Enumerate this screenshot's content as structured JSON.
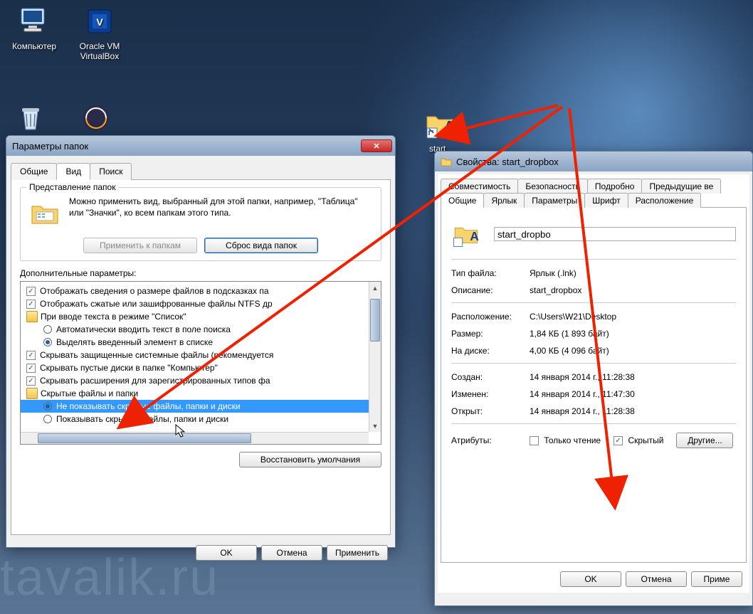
{
  "watermark": "tavalik.ru",
  "desktop": {
    "computer": "Компьютер",
    "virtualbox": "Oracle VM VirtualBox",
    "start_dropbox": "start_"
  },
  "folderOptions": {
    "title": "Параметры папок",
    "tabs": {
      "general": "Общие",
      "view": "Вид",
      "search": "Поиск"
    },
    "folderViews": {
      "legend": "Представление папок",
      "desc": "Можно применить вид, выбранный для этой папки, например, \"Таблица\" или \"Значки\", ко всем папкам этого типа.",
      "apply": "Применить к папкам",
      "reset": "Сброс вида папок"
    },
    "advLabel": "Дополнительные параметры:",
    "tree": [
      {
        "type": "chk",
        "checked": true,
        "indent": 0,
        "text": "Отображать сведения о размере файлов в подсказках па"
      },
      {
        "type": "chk",
        "checked": true,
        "indent": 0,
        "text": "Отображать сжатые или зашифрованные файлы NTFS др"
      },
      {
        "type": "folder",
        "indent": 0,
        "text": "При вводе текста в режиме \"Список\""
      },
      {
        "type": "radio",
        "sel": false,
        "indent": 1,
        "text": "Автоматически вводить текст в поле поиска"
      },
      {
        "type": "radio",
        "sel": true,
        "indent": 1,
        "text": "Выделять введенный элемент в списке"
      },
      {
        "type": "chk",
        "checked": true,
        "indent": 0,
        "text": "Скрывать защищенные системные файлы (рекомендуется"
      },
      {
        "type": "chk",
        "checked": true,
        "indent": 0,
        "text": "Скрывать пустые диски в папке \"Компьютер\""
      },
      {
        "type": "chk",
        "checked": true,
        "indent": 0,
        "text": "Скрывать расширения для зарегистрированных типов фа"
      },
      {
        "type": "folder",
        "indent": 0,
        "text": "Скрытые файлы и папки"
      },
      {
        "type": "radio",
        "sel": true,
        "indent": 1,
        "selected": true,
        "text": "Не показывать скрытые файлы, папки и диски"
      },
      {
        "type": "radio",
        "sel": false,
        "indent": 1,
        "text": "Показывать скрытые файлы, папки и диски"
      }
    ],
    "restore": "Восстановить умолчания",
    "ok": "OK",
    "cancel": "Отмена",
    "apply": "Применить"
  },
  "props": {
    "title": "Свойства: start_dropbox",
    "tabsRow1": [
      "Совместимость",
      "Безопасность",
      "Подробно",
      "Предыдущие ве"
    ],
    "tabsRow2": [
      "Общие",
      "Ярлык",
      "Параметры",
      "Шрифт",
      "Расположение"
    ],
    "name": "start_dropbo",
    "rows": {
      "type_k": "Тип файла:",
      "type_v": "Ярлык (.lnk)",
      "desc_k": "Описание:",
      "desc_v": "start_dropbox",
      "loc_k": "Расположение:",
      "loc_v": "C:\\Users\\W21\\Desktop",
      "size_k": "Размер:",
      "size_v": "1,84 КБ (1 893 байт)",
      "disk_k": "На диске:",
      "disk_v": "4,00 КБ (4 096 байт)",
      "created_k": "Создан:",
      "created_v": "14 января 2014 г., 11:28:38",
      "modified_k": "Изменен:",
      "modified_v": "14 января 2014 г., 11:47:30",
      "opened_k": "Открыт:",
      "opened_v": "14 января 2014 г., 11:28:38",
      "attr_k": "Атрибуты:",
      "readonly": "Только чтение",
      "hidden": "Скрытый",
      "other": "Другие..."
    },
    "ok": "OK",
    "cancel": "Отмена",
    "apply": "Приме"
  }
}
